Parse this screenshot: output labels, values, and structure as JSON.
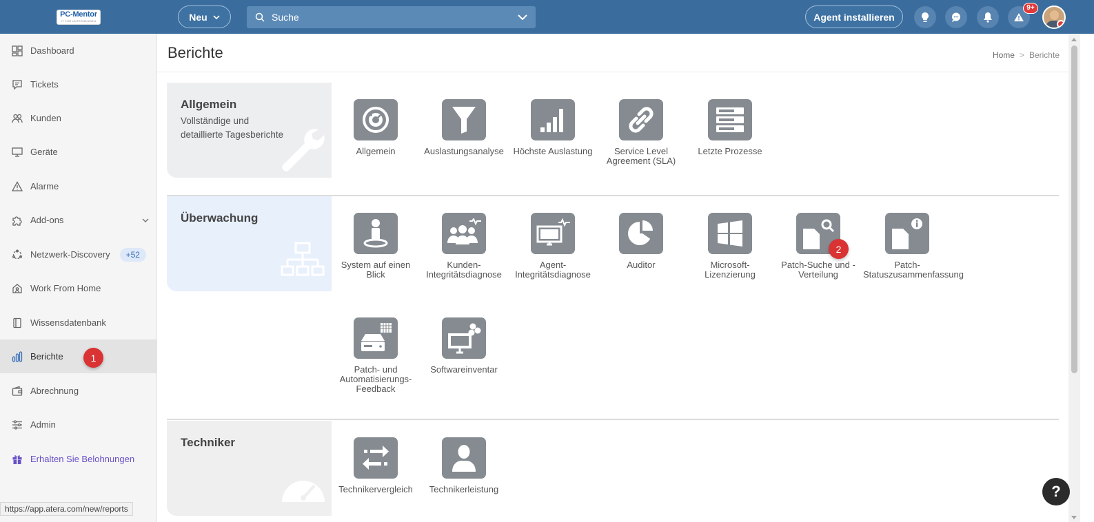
{
  "topbar": {
    "logo_main": "PC-Mentor",
    "logo_tag": "IT FÜR UNTERNEHMEN",
    "new_button": "Neu",
    "search_placeholder": "Suche",
    "agent_button": "Agent installieren",
    "alerts_badge": "9+"
  },
  "sidebar": {
    "items": [
      {
        "label": "Dashboard",
        "icon": "dashboard-icon"
      },
      {
        "label": "Tickets",
        "icon": "ticket-icon"
      },
      {
        "label": "Kunden",
        "icon": "customers-icon"
      },
      {
        "label": "Geräte",
        "icon": "monitor-icon"
      },
      {
        "label": "Alarme",
        "icon": "warning-icon"
      },
      {
        "label": "Add-ons",
        "icon": "puzzle-icon"
      },
      {
        "label": "Netzwerk-Discovery",
        "icon": "network-icon",
        "badge": "+52"
      },
      {
        "label": "Work From Home",
        "icon": "home-icon"
      },
      {
        "label": "Wissensdatenbank",
        "icon": "book-icon"
      },
      {
        "label": "Berichte",
        "icon": "bar-chart-icon",
        "active": true
      },
      {
        "label": "Abrechnung",
        "icon": "wallet-icon"
      },
      {
        "label": "Admin",
        "icon": "sliders-icon"
      },
      {
        "label": "Erhalten Sie Belohnungen",
        "icon": "gift-icon"
      }
    ]
  },
  "markers": {
    "m1": "1",
    "m2": "2"
  },
  "page": {
    "title": "Berichte",
    "breadcrumb_home": "Home",
    "breadcrumb_sep": ">",
    "breadcrumb_current": "Berichte"
  },
  "categories": {
    "allgemein": {
      "title": "Allgemein",
      "desc": "Vollständige und detaillierte Tagesberichte"
    },
    "ueberwachung": {
      "title": "Überwachung"
    },
    "techniker": {
      "title": "Techniker"
    }
  },
  "reports": {
    "allgemein": [
      "Allgemein",
      "Auslastungsanalyse",
      "Höchste Auslastung",
      "Service Level Agreement (SLA)",
      "Letzte Prozesse"
    ],
    "ueberwachung": [
      "System auf einen Blick",
      "Kunden-Integritätsdiagnose",
      "Agent-Integritätsdiagnose",
      "Auditor",
      "Microsoft-Lizenzierung",
      "Patch-Suche und -Verteilung",
      "Patch-Statuszusammenfassung",
      "Patch- und Automatisierungs-Feedback",
      "Softwareinventar"
    ],
    "techniker": [
      "Technikervergleich",
      "Technikerleistung"
    ]
  },
  "status_url": "https://app.atera.com/new/reports",
  "help_label": "?"
}
